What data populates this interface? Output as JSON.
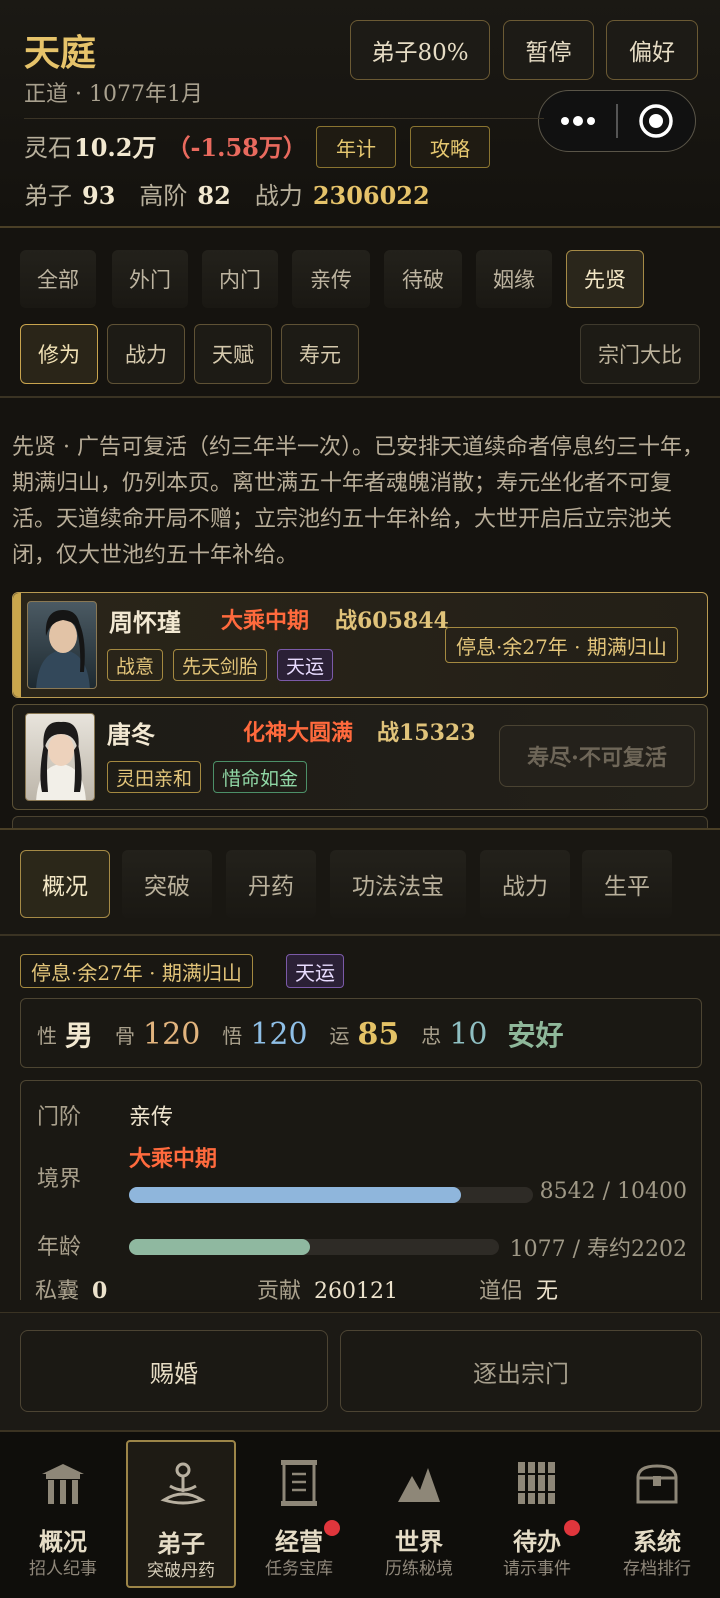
{
  "header": {
    "title": "天庭",
    "subtitle": "正道 · 1077年1月",
    "btn_disciple": "弟子80%",
    "btn_pause": "暂停",
    "btn_pref": "偏好",
    "spirit_label": "灵石",
    "spirit_value": "10.2万",
    "spirit_delta": "（-1.58万）",
    "btn_yearly": "年计",
    "btn_guide": "攻略",
    "disciples_label": "弟子",
    "disciples_value": "93",
    "senior_label": "高阶",
    "senior_value": "82",
    "power_label": "战力",
    "power_value": "2306022"
  },
  "category_tabs": [
    "全部",
    "外门",
    "内门",
    "亲传",
    "待破",
    "姻缘",
    "先贤"
  ],
  "active_category": "先贤",
  "sort_tabs": [
    "修为",
    "战力",
    "天赋",
    "寿元"
  ],
  "active_sort": "修为",
  "sect_compare": "宗门大比",
  "notice": "先贤 · 广告可复活（约三年半一次）。已安排天道续命者停息约三十年，期满归山，仍列本页。离世满五十年者魂魄消散；寿元坐化者不可复活。天道续命开局不赠；立宗池约五十年补给，大世开启后立宗池关闭，仅大世池约五十年补给。",
  "disciples": [
    {
      "name": "周怀瑾",
      "realm": "大乘中期",
      "power": "战605844",
      "tags": [
        "战意",
        "先天剑胎",
        "天运"
      ],
      "status": "停息·余27年 · 期满归山"
    },
    {
      "name": "唐冬",
      "realm": "化神大圆满",
      "power": "战15323",
      "tags": [
        "灵田亲和",
        "惜命如金"
      ],
      "status": "寿尽·不可复活"
    }
  ],
  "detail_tabs": [
    "概况",
    "突破",
    "丹药",
    "功法法宝",
    "战力",
    "生平"
  ],
  "active_detail": "概况",
  "detail": {
    "status": "停息·余27年 · 期满归山",
    "luck_tag": "天运",
    "gender_label": "性",
    "gender": "男",
    "bone_label": "骨",
    "bone": "120",
    "wit_label": "悟",
    "wit": "120",
    "luck_label": "运",
    "luck": "85",
    "loyalty_label": "忠",
    "loyalty": "10",
    "condition": "安好",
    "rank_label": "门阶",
    "rank": "亲传",
    "realm_label": "境界",
    "realm": "大乘中期",
    "realm_progress_text": "8542 / 10400",
    "realm_progress": 0.821,
    "age_label": "年龄",
    "age_progress_text": "1077 / 寿约2202",
    "age_progress": 0.489,
    "purse_label": "私囊",
    "purse": "0",
    "contrib_label": "贡献",
    "contrib": "260121",
    "partner_label": "道侣",
    "partner": "无"
  },
  "actions": {
    "marry": "赐婚",
    "expel": "逐出宗门"
  },
  "nav": [
    {
      "title": "概况",
      "sub": "招人纪事",
      "icon": "gate-icon"
    },
    {
      "title": "弟子",
      "sub": "突破丹药",
      "icon": "meditation-icon"
    },
    {
      "title": "经营",
      "sub": "任务宝库",
      "icon": "scroll-icon"
    },
    {
      "title": "世界",
      "sub": "历练秘境",
      "icon": "mountain-icon"
    },
    {
      "title": "待办",
      "sub": "请示事件",
      "icon": "bamboo-slips-icon"
    },
    {
      "title": "系统",
      "sub": "存档排行",
      "icon": "chest-icon"
    }
  ],
  "colors": {
    "gold": "#e0c37a",
    "realm_red": "#ff6a3d",
    "delta_red": "#e96a5e",
    "realm_bar": "#8fb6dc",
    "age_bar": "#8fb8a0"
  }
}
